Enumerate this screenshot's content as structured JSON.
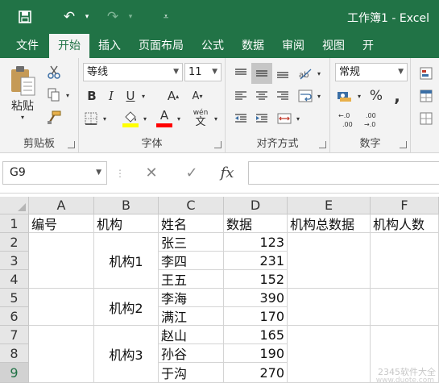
{
  "titlebar": {
    "workbook_title": "工作簿1 - Excel",
    "save_icon": "floppy-disk-icon",
    "undo_icon": "undo-icon",
    "redo_icon": "redo-icon",
    "customize_icon": "customize-quick-access-icon"
  },
  "tabs": [
    "文件",
    "开始",
    "插入",
    "页面布局",
    "公式",
    "数据",
    "审阅",
    "视图",
    "开"
  ],
  "active_tab": "开始",
  "ribbon": {
    "clipboard": {
      "label": "剪贴板",
      "paste_label": "粘贴"
    },
    "font": {
      "label": "字体",
      "font_name": "等线",
      "font_size": "11",
      "bold": "B",
      "italic": "I",
      "underline": "U",
      "grow": "A",
      "shrink": "A",
      "fill_color": "#ffff00",
      "font_color": "#ff0000",
      "phonetic": "wén"
    },
    "alignment": {
      "label": "对齐方式"
    },
    "number": {
      "label": "数字",
      "format": "常规",
      "percent": "%",
      "comma": ",",
      "inc_decimal": "←.0 .00",
      "dec_decimal": ".00 →.0"
    }
  },
  "formula_bar": {
    "name_box": "G9",
    "cancel": "✕",
    "enter": "✓",
    "fx": "fx",
    "content": ""
  },
  "sheet": {
    "columns": [
      "A",
      "B",
      "C",
      "D",
      "E",
      "F"
    ],
    "rows": [
      "1",
      "2",
      "3",
      "4",
      "5",
      "6",
      "7",
      "8",
      "9"
    ],
    "selected_row": "9",
    "header_row": [
      "编号",
      "机构",
      "姓名",
      "数据",
      "机构总数据",
      "机构人数"
    ],
    "names": [
      "张三",
      "李四",
      "王五",
      "李海",
      "满江",
      "赵山",
      "孙谷",
      "于沟"
    ],
    "values": [
      "123",
      "231",
      "152",
      "390",
      "170",
      "165",
      "190",
      "270"
    ],
    "merged_orgs": [
      "机构1",
      "机构2",
      "机构3"
    ]
  },
  "watermark": {
    "line1": "2345软件大全",
    "line2": "www.duote.com"
  }
}
